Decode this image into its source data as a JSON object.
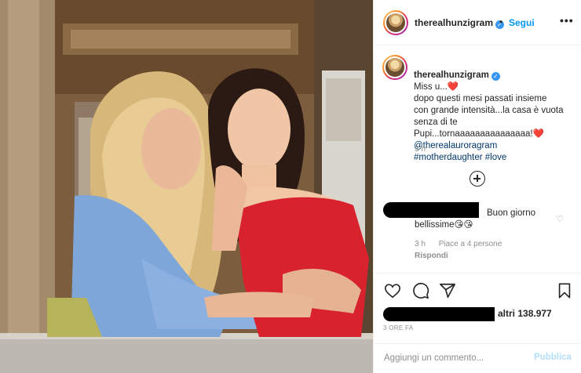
{
  "post": {
    "username": "therealhunzigram",
    "verified_symbol": "✓",
    "dot": "•",
    "follow_label": "Segui",
    "more_label": "•••"
  },
  "caption": {
    "username": "therealhunzigram",
    "text": "Miss u...❤️\ndopo questi mesi passati insieme\ncon grande intensità...la casa è vuota\nsenza di te\nPupi...tornaaaaaaaaaaaaaaa!❤️",
    "tags": "@therealauroragram\n#motherdaughter #love",
    "time": "3 h"
  },
  "comment": {
    "text": "Buon giorno\nbellissime😘😘",
    "time": "3 h",
    "likes": "Piace a 4 persone",
    "reply": "Rispondi",
    "heart": "♡"
  },
  "likes": {
    "text": "altri 138.977"
  },
  "post_time": "3 ORE FA",
  "add_comment": {
    "placeholder": "Aggiungi un commento...",
    "publish_label": "Pubblica"
  },
  "icons": [
    "like-icon",
    "comment-icon",
    "share-icon",
    "save-icon",
    "add-icon",
    "verified-icon"
  ],
  "colors": {
    "link_blue": "#0095f6",
    "tag_blue": "#00376b",
    "muted": "#8e8e8e",
    "publish_disabled": "#b2dffc"
  }
}
